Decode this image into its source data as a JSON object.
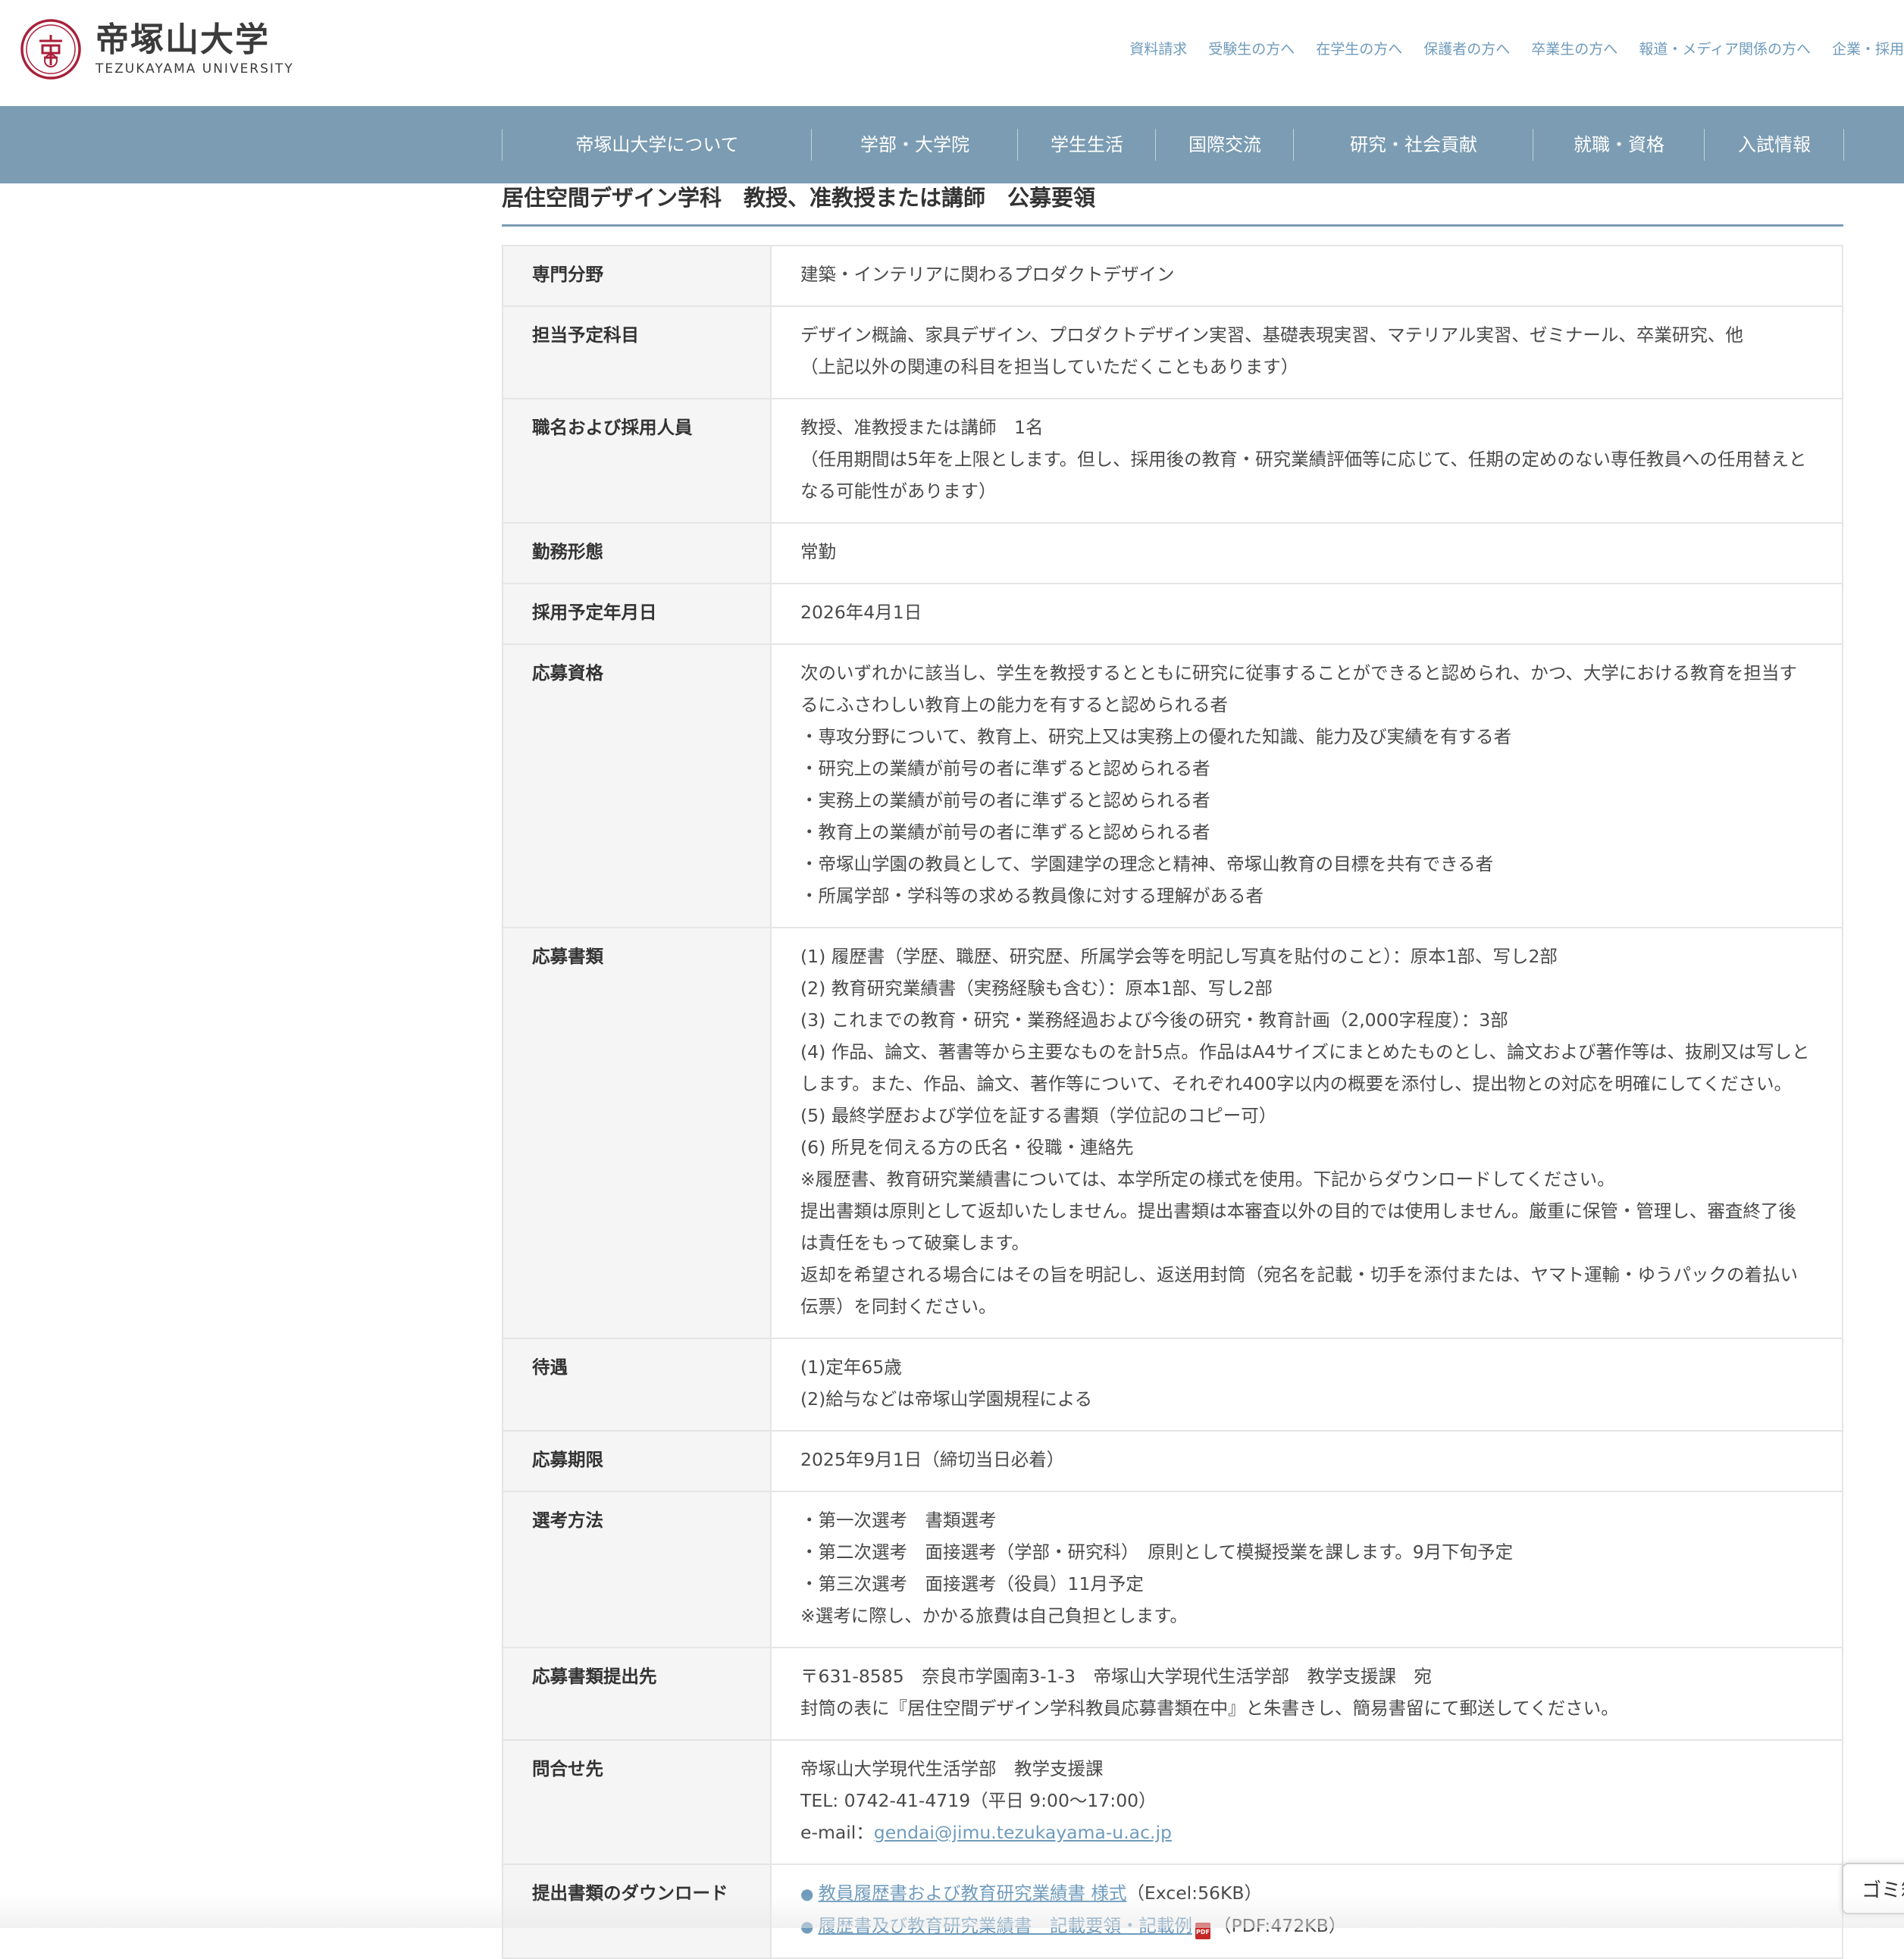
{
  "header": {
    "logo_jp": "帝塚山大学",
    "logo_en": "TEZUKAYAMA UNIVERSITY",
    "logo_icon": "university-crest-icon",
    "utility_nav": [
      "資料請求",
      "受験生の方へ",
      "在学生の方へ",
      "保護者の方へ",
      "卒業生の方へ",
      "報道・メディア関係の方へ",
      "企業・採用"
    ]
  },
  "global_nav": [
    "帝塚山大学について",
    "学部・大学院",
    "学生生活",
    "国際交流",
    "研究・社会貢献",
    "就職・資格",
    "入試情報"
  ],
  "page": {
    "title": "居住空間デザイン学科　教授、准教授または講師　公募要領"
  },
  "table": {
    "rows": [
      {
        "label": "専門分野",
        "lines": [
          "建築・インテリアに関わるプロダクトデザイン"
        ]
      },
      {
        "label": "担当予定科目",
        "lines": [
          "デザイン概論、家具デザイン、プロダクトデザイン実習、基礎表現実習、マテリアル実習、ゼミナール、卒業研究、他",
          "（上記以外の関連の科目を担当していただくこともあります）"
        ]
      },
      {
        "label": "職名および採用人員",
        "lines": [
          "教授、准教授または講師　1名",
          "（任用期間は5年を上限とします。但し、採用後の教育・研究業績評価等に応じて、任期の定めのない専任教員への任用替えとなる可能性があります）"
        ]
      },
      {
        "label": "勤務形態",
        "lines": [
          "常勤"
        ]
      },
      {
        "label": "採用予定年月日",
        "lines": [
          "2026年4月1日"
        ]
      },
      {
        "label": "応募資格",
        "lines": [
          "次のいずれかに該当し、学生を教授するとともに研究に従事することができると認められ、かつ、大学における教育を担当するにふさわしい教育上の能力を有すると認められる者",
          "・専攻分野について、教育上、研究上又は実務上の優れた知識、能力及び実績を有する者",
          "・研究上の業績が前号の者に準ずると認められる者",
          "・実務上の業績が前号の者に準ずると認められる者",
          "・教育上の業績が前号の者に準ずると認められる者",
          "・帝塚山学園の教員として、学園建学の理念と精神、帝塚山教育の目標を共有できる者",
          "・所属学部・学科等の求める教員像に対する理解がある者"
        ]
      },
      {
        "label": "応募書類",
        "lines": [
          "(1) 履歴書（学歴、職歴、研究歴、所属学会等を明記し写真を貼付のこと）：原本1部、写し2部",
          "(2) 教育研究業績書（実務経験も含む）：原本1部、写し2部",
          "(3) これまでの教育・研究・業務経過および今後の研究・教育計画（2,000字程度）：3部",
          "(4) 作品、論文、著書等から主要なものを計5点。作品はA4サイズにまとめたものとし、論文および著作等は、抜刷又は写しとします。また、作品、論文、著作等について、それぞれ400字以内の概要を添付し、提出物との対応を明確にしてください。",
          "(5) 最終学歴および学位を証する書類（学位記のコピー可）",
          "(6) 所見を伺える方の氏名・役職・連絡先",
          "※履歴書、教育研究業績書については、本学所定の様式を使用。下記からダウンロードしてください。",
          "提出書類は原則として返却いたしません。提出書類は本審査以外の目的では使用しません。厳重に保管・管理し、審査終了後は責任をもって破棄します。",
          "返却を希望される場合にはその旨を明記し、返送用封筒（宛名を記載・切手を添付または、ヤマト運輸・ゆうパックの着払い伝票）を同封ください。"
        ]
      },
      {
        "label": "待遇",
        "lines": [
          "(1)定年65歳",
          "(2)給与などは帝塚山学園規程による"
        ]
      },
      {
        "label": "応募期限",
        "lines": [
          "2025年9月1日（締切当日必着）"
        ]
      },
      {
        "label": "選考方法",
        "lines": [
          "・第一次選考　書類選考",
          "・第二次選考　面接選考（学部・研究科）　原則として模擬授業を課します。9月下旬予定",
          "・第三次選考　面接選考（役員）11月予定",
          "※選考に際し、かかる旅費は自己負担とします。"
        ]
      },
      {
        "label": "応募書類提出先",
        "lines": [
          "〒631-8585　奈良市学園南3-1-3　帝塚山大学現代生活学部　教学支援課　宛",
          "封筒の表に『居住空間デザイン学科教員応募書類在中』と朱書きし、簡易書留にて郵送してください。"
        ]
      }
    ],
    "contact": {
      "label": "問合せ先",
      "org": "帝塚山大学現代生活学部　教学支援課",
      "tel": "TEL: 0742-41-4719（平日 9:00〜17:00）",
      "email_prefix": "e-mail：",
      "email": "gendai@jimu.tezukayama-u.ac.jp"
    },
    "downloads": {
      "label": "提出書類のダウンロード",
      "items": [
        {
          "link": "教員履歴書および教育研究業績書 様式",
          "meta": "（Excel:56KB）",
          "pdf": false
        },
        {
          "link": "履歴書及び教育研究業績書　記載要領・記載例",
          "meta": "（PDF:472KB）",
          "pdf": true
        }
      ]
    }
  },
  "floating_tab": {
    "label": "ゴミ箱"
  },
  "colors": {
    "nav_bg": "#7b9cb2",
    "link": "#6f9bbc",
    "logo_red": "#a8203a"
  }
}
